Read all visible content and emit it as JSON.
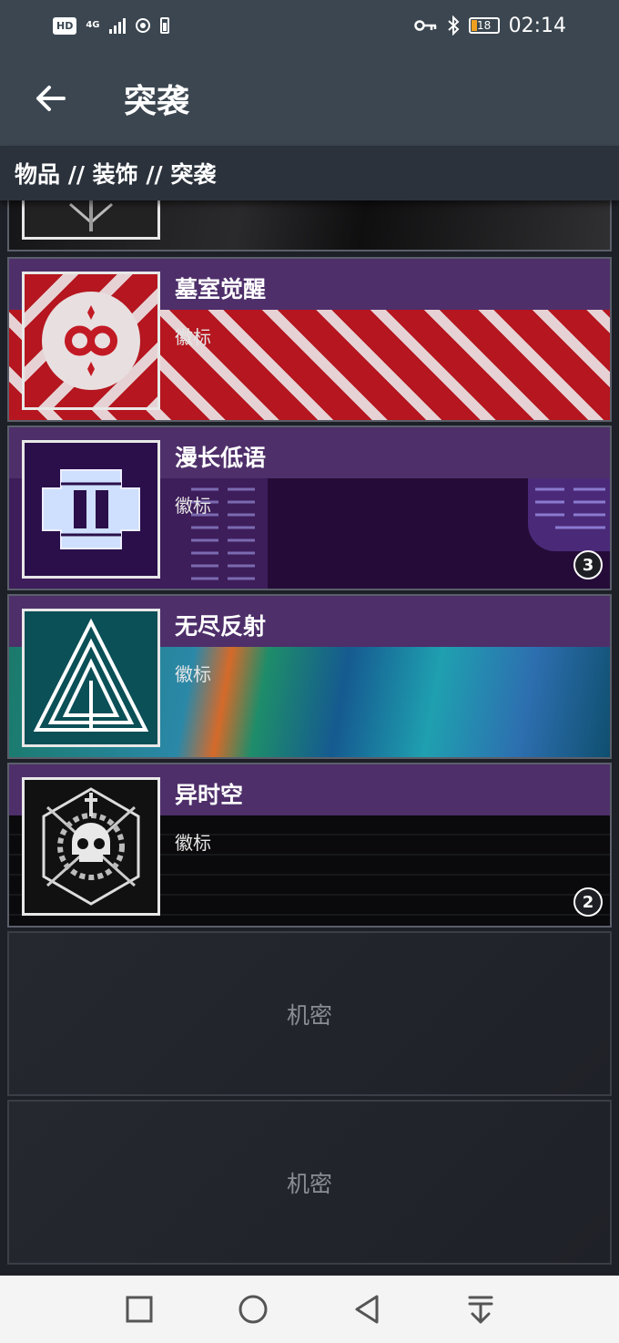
{
  "status_bar": {
    "hd": "HD",
    "network": "4G",
    "battery_level": "18",
    "time": "02:14"
  },
  "app_bar": {
    "title": "突袭"
  },
  "breadcrumb": "物品 // 装饰 // 突袭",
  "items": [
    {
      "name": "墓室觉醒",
      "type": "徽标",
      "badge": ""
    },
    {
      "name": "漫长低语",
      "type": "徽标",
      "badge": "3"
    },
    {
      "name": "无尽反射",
      "type": "徽标",
      "badge": ""
    },
    {
      "name": "异时空",
      "type": "徽标",
      "badge": "2"
    }
  ],
  "locked_items": [
    {
      "label": "机密"
    },
    {
      "label": "机密"
    }
  ],
  "nav": {
    "icons": [
      "square-icon",
      "circle-icon",
      "triangle-back-icon",
      "notification-drawer-icon"
    ]
  },
  "colors": {
    "header": "#3b4650",
    "band_purple": "#4e2f6a",
    "list_bg": "#1e2027"
  }
}
